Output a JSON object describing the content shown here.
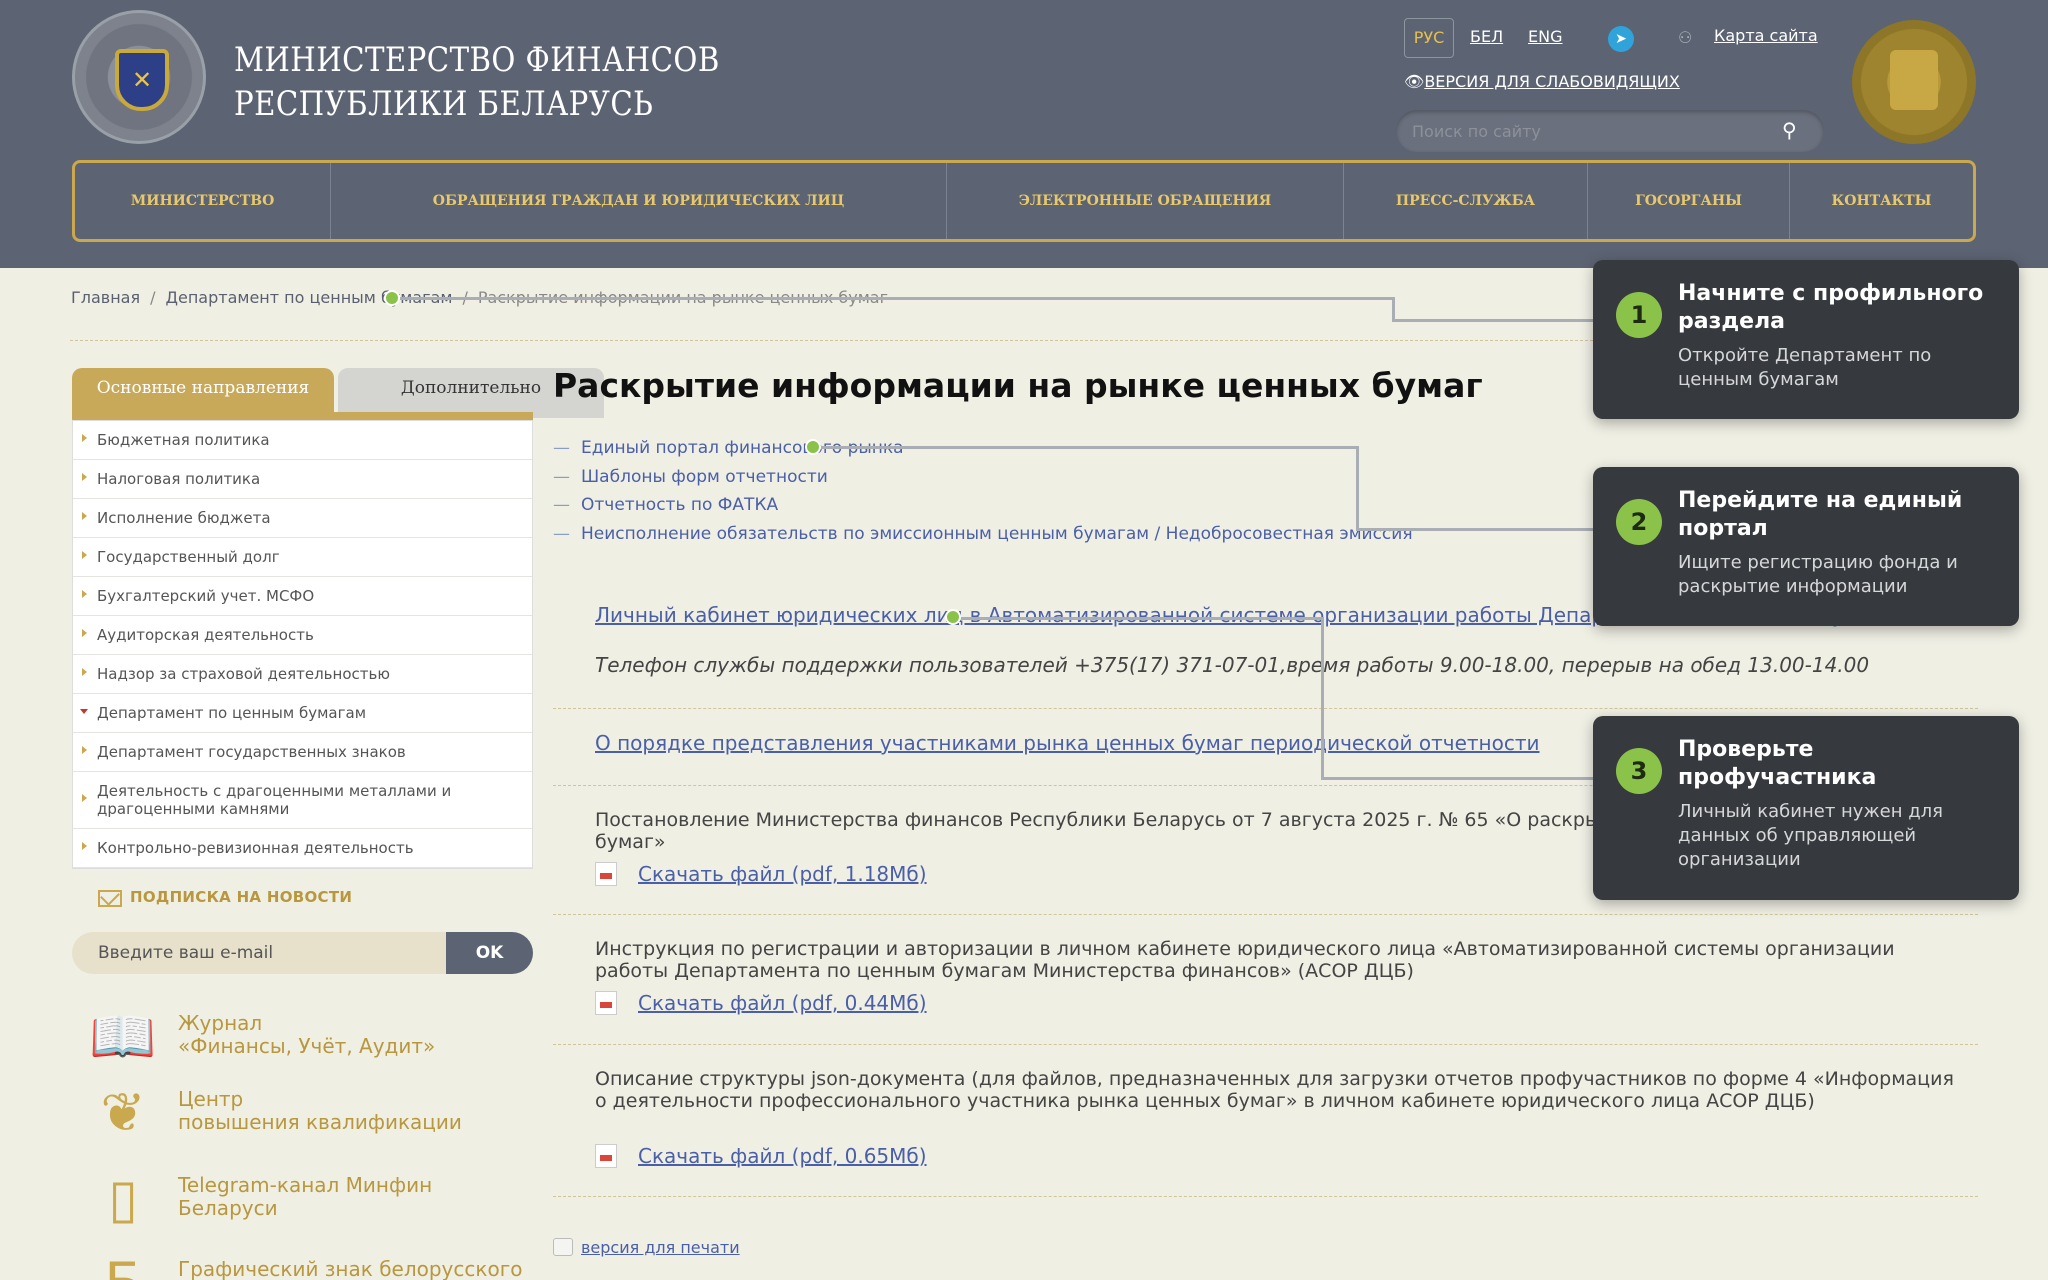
{
  "header": {
    "title_line1": "МИНИСТЕРСТВО ФИНАНСОВ",
    "title_line2": "РЕСПУБЛИКИ БЕЛАРУСЬ",
    "languages": [
      "РУС",
      "БЕЛ",
      "ENG"
    ],
    "sitemap": "Карта сайта",
    "vision_version": "ВЕРСИЯ ДЛЯ СЛАБОВИДЯЩИХ",
    "search_placeholder": "Поиск по сайту"
  },
  "nav": [
    "МИНИСТЕРСТВО",
    "ОБРАЩЕНИЯ ГРАЖДАН И ЮРИДИЧЕСКИХ ЛИЦ",
    "ЭЛЕКТРОННЫЕ ОБРАЩЕНИЯ",
    "ПРЕСС-СЛУЖБА",
    "ГОСОРГАНЫ",
    "КОНТАКТЫ"
  ],
  "breadcrumb": {
    "home": "Главная",
    "department": "Департамент по ценным бумагам",
    "current": "Раскрытие информации на рынке ценных бумаг"
  },
  "sidebar": {
    "tab_main": "Основные направления",
    "tab_extra": "Дополнительно",
    "items": [
      "Бюджетная политика",
      "Налоговая политика",
      "Исполнение бюджета",
      "Государственный долг",
      "Бухгалтерский учет. МСФО",
      "Аудиторская деятельность",
      "Надзор за страховой деятельностью",
      "Департамент по ценным бумагам",
      "Департамент государственных знаков",
      "Деятельность с драгоценными металлами и драгоценными камнями",
      "Контрольно-ревизионная деятельность"
    ],
    "subscribe_title": "ПОДПИСКА НА НОВОСТИ",
    "email_placeholder": "Введите ваш e-mail",
    "ok": "OK",
    "promos": [
      "Журнал\n«Финансы, Учёт, Аудит»",
      "Центр\nповышения квалификации",
      "Telegram-канал Минфин\nБеларуси",
      "Графический знак белорусского"
    ]
  },
  "main": {
    "title": "Раскрытие информации на рынке ценных бумаг",
    "links": [
      "Единый портал финансового рынка",
      "Шаблоны форм отчетности",
      "Отчетность по ФАТКА",
      "Неисполнение обязательств по эмиссионным ценным бумагам / Недобросовестная эмиссия"
    ],
    "cabinet_link": "Личный кабинет юридических лиц в Автоматизированной системе организации работы Департамента по ценным бумагам",
    "phone": "Телефон службы поддержки пользователей +375(17) 371-07-01,время работы 9.00-18.00, перерыв на обед 13.00-14.00",
    "order_link": "О порядке представления участниками рынка ценных бумаг периодической отчетности",
    "docs": [
      {
        "text": "Постановление Министерства финансов Республики Беларусь от 7 августа 2025 г. № 65 «О раскрытии информации на рынке ценных бумаг»",
        "file": "Скачать файл (pdf, 1.18Мб)"
      },
      {
        "text": "Инструкция по регистрации и авторизации в личном кабинете юридического лица «Автоматизированной системы организации работы Департамента по ценным бумагам Министерства финансов» (АСОР ДЦБ)",
        "file": "Скачать файл (pdf, 0.44Мб)"
      },
      {
        "text": "Описание структуры json-документа (для файлов, предназначенных для загрузки отчетов профучастников по форме 4 «Информация о деятельности профессионального участника рынка ценных бумаг» в личном кабинете юридического лица АСОР ДЦБ)",
        "file": "Скачать файл (pdf, 0.65Мб)"
      }
    ],
    "print": "версия для печати"
  },
  "tutorial": [
    {
      "num": "1",
      "title": "Начните с профильного раздела",
      "desc": "Откройте Департамент по ценным бумагам"
    },
    {
      "num": "2",
      "title": "Перейдите на единый портал",
      "desc": "Ищите регистрацию фонда и раскрытие информации"
    },
    {
      "num": "3",
      "title": "Проверьте профучастника",
      "desc": "Личный кабинет нужен для данных об управляющей организации"
    }
  ],
  "colors": {
    "header": "#5c6372",
    "gold": "#c9a84e",
    "accent_green": "#8bc34a",
    "card_bg": "#36393d",
    "link": "#4a5fa8"
  }
}
